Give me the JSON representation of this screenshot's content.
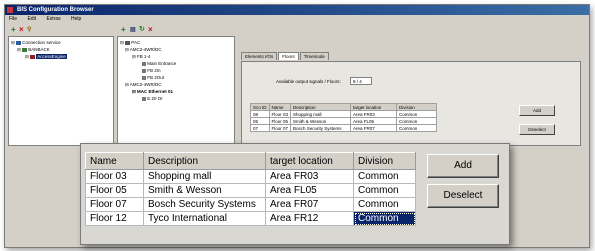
{
  "window": {
    "title": "BIS Configuration Browser",
    "menu": [
      "File",
      "Edit",
      "Extras",
      "Help"
    ]
  },
  "left_tree": {
    "items": [
      "Connection service",
      "BANBACK",
      "AccessEngine"
    ]
  },
  "middle_tree": {
    "items": [
      "PAC",
      "AMC2-4WR/DC",
      "FB 1-4",
      "Main Entrance",
      "FB 2In",
      "FB 2Out",
      "AMC2-4WR/DC",
      "MAC Ethernet 01",
      "E.20 Or"
    ]
  },
  "tabs": [
    "Elements I/Os",
    "Floors",
    "Timemode"
  ],
  "available_label": "Available output signals / Floors:",
  "available_value": "8 / 4",
  "small_table": {
    "headers": [
      "Sco ID",
      "Name",
      "Description",
      "target location",
      "Division"
    ],
    "rows": [
      [
        "08",
        "Floor 03",
        "Shopping mall",
        "Area FR03",
        "Common"
      ],
      [
        "05",
        "Floor 05",
        "Smith & Wesson",
        "Area FL05",
        "Common"
      ],
      [
        "07",
        "Floor 07",
        "Bosch Security Systems",
        "Area FR07",
        "Common"
      ]
    ],
    "add_label": "Add",
    "deselect_label": "Deselect"
  },
  "zoom_table": {
    "headers": [
      "Name",
      "Description",
      "target location",
      "Division"
    ],
    "rows": [
      [
        "Floor 03",
        "Shopping mall",
        "Area FR03",
        "Common"
      ],
      [
        "Floor 05",
        "Smith & Wesson",
        "Area FL05",
        "Common"
      ],
      [
        "Floor 07",
        "Bosch Security Systems",
        "Area FR07",
        "Common"
      ],
      [
        "Floor 12",
        "Tyco International",
        "Area FR12",
        "Common"
      ]
    ],
    "add_label": "Add",
    "deselect_label": "Deselect"
  },
  "colors": {
    "selection": "#0a246a",
    "face": "#d4d0c8",
    "title_start": "#0a246a"
  }
}
